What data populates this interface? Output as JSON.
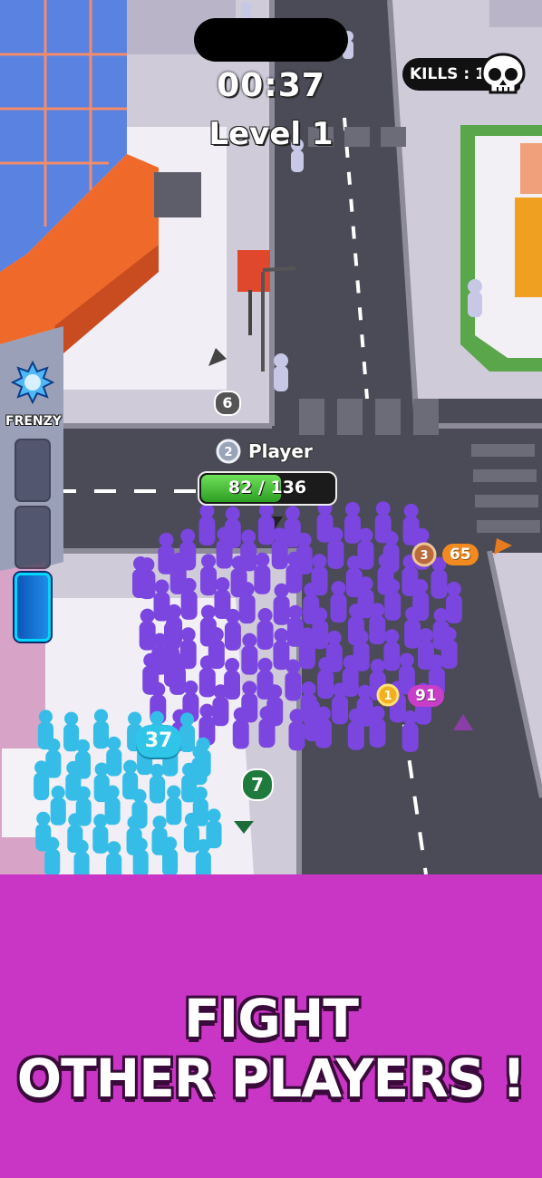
{
  "hud": {
    "timer": "00:37",
    "level": "Level 1",
    "kills": "KILLS : 1",
    "frenzy_label": "FRENZY"
  },
  "player": {
    "name": "Player",
    "rank": "2",
    "health": {
      "current": 82,
      "max": 136,
      "text": "82 / 136"
    }
  },
  "enemies": [
    {
      "rank": "3",
      "count": "65",
      "color": "#f38a1f"
    },
    {
      "rank": "1",
      "count": "91",
      "color": "#c93ec8"
    }
  ],
  "crowd_counts": {
    "cyan_group": "37",
    "green_group": "7",
    "grey_group": "6"
  },
  "colors": {
    "player_crowd": "#7b45e0",
    "cyan_crowd": "#2ec5e9",
    "promo_background": "#c936c6",
    "health_fill": "#3cbf2b"
  },
  "promo": {
    "line1": "FIGHT",
    "line2": "OTHER PLAYERS !"
  }
}
